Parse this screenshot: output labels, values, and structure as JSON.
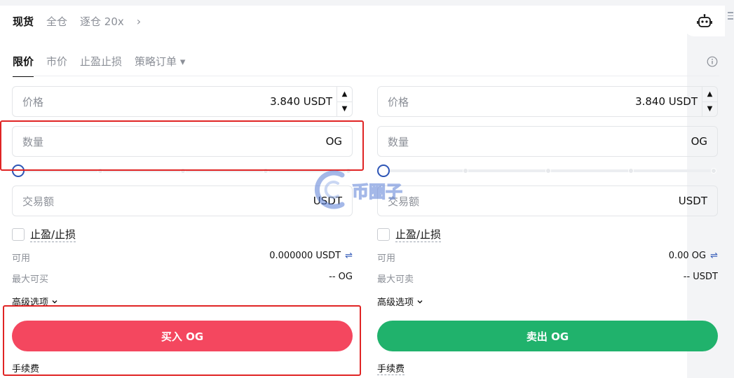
{
  "mode_tabs": {
    "spot": "现货",
    "cross": "全仓",
    "isolated": "逐仓 20x",
    "more": "›"
  },
  "order_tabs": {
    "limit": "限价",
    "market": "市价",
    "tpsl": "止盈止损",
    "strategy": "策略订单 ▾"
  },
  "buy": {
    "price_label": "价格",
    "price_value": "3.840 USDT",
    "qty_label": "数量",
    "qty_unit": "OG",
    "amount_label": "交易额",
    "amount_unit": "USDT",
    "tpsl_label": "止盈/止损",
    "available_label": "可用",
    "available_value": "0.000000 USDT",
    "max_label": "最大可买",
    "max_value": "-- OG",
    "advanced_label": "高级选项",
    "button_label": "买入 OG",
    "fee_label": "手续费"
  },
  "sell": {
    "price_label": "价格",
    "price_value": "3.840 USDT",
    "qty_label": "数量",
    "qty_unit": "OG",
    "amount_label": "交易额",
    "amount_unit": "USDT",
    "tpsl_label": "止盈/止损",
    "available_label": "可用",
    "available_value": "0.00 OG",
    "max_label": "最大可卖",
    "max_value": "-- USDT",
    "advanced_label": "高级选项",
    "button_label": "卖出 OG",
    "fee_label": "手续费"
  },
  "slider_percent": 0,
  "watermark_text": "币圈子",
  "icons": {
    "robot": "robot-icon",
    "info": "info-icon",
    "swap": "swap-icon",
    "chevron": "chevron-down-icon"
  },
  "colors": {
    "buy": "#f4475f",
    "sell": "#20b26c",
    "accent": "#2d55b6",
    "highlight": "#e02424"
  }
}
